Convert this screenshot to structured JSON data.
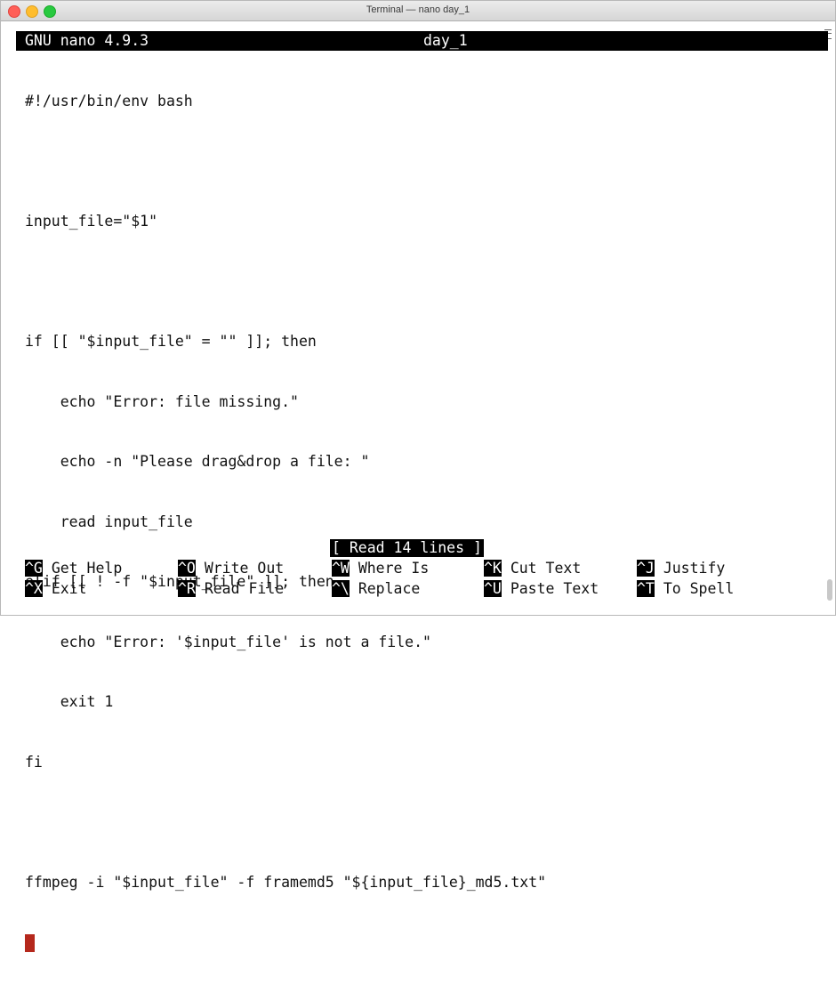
{
  "window": {
    "title": "Terminal — nano day_1"
  },
  "nano": {
    "version": "GNU nano 4.9.3",
    "filename": "day_1",
    "lines": [
      "#!/usr/bin/env bash",
      "",
      "input_file=\"$1\"",
      "",
      "if [[ \"$input_file\" = \"\" ]]; then",
      "    echo \"Error: file missing.\"",
      "    echo -n \"Please drag&drop a file: \"",
      "    read input_file",
      "elif [[ ! -f \"$input_file\" ]]; then",
      "    echo \"Error: '$input_file' is not a file.\"",
      "    exit 1",
      "fi",
      "",
      "ffmpeg -i \"$input_file\" -f framemd5 \"${input_file}_md5.txt\""
    ],
    "status": "[ Read 14 lines ]",
    "shortcuts": [
      {
        "key": "^G",
        "label": "Get Help"
      },
      {
        "key": "^O",
        "label": "Write Out"
      },
      {
        "key": "^W",
        "label": "Where Is"
      },
      {
        "key": "^K",
        "label": "Cut Text"
      },
      {
        "key": "^J",
        "label": "Justify"
      },
      {
        "key": "^X",
        "label": "Exit"
      },
      {
        "key": "^R",
        "label": "Read File"
      },
      {
        "key": "^\\",
        "label": "Replace"
      },
      {
        "key": "^U",
        "label": "Paste Text"
      },
      {
        "key": "^T",
        "label": "To Spell"
      }
    ]
  },
  "colors": {
    "cursor": "#b5281c",
    "header_bg": "#000000",
    "text": "#111111"
  }
}
